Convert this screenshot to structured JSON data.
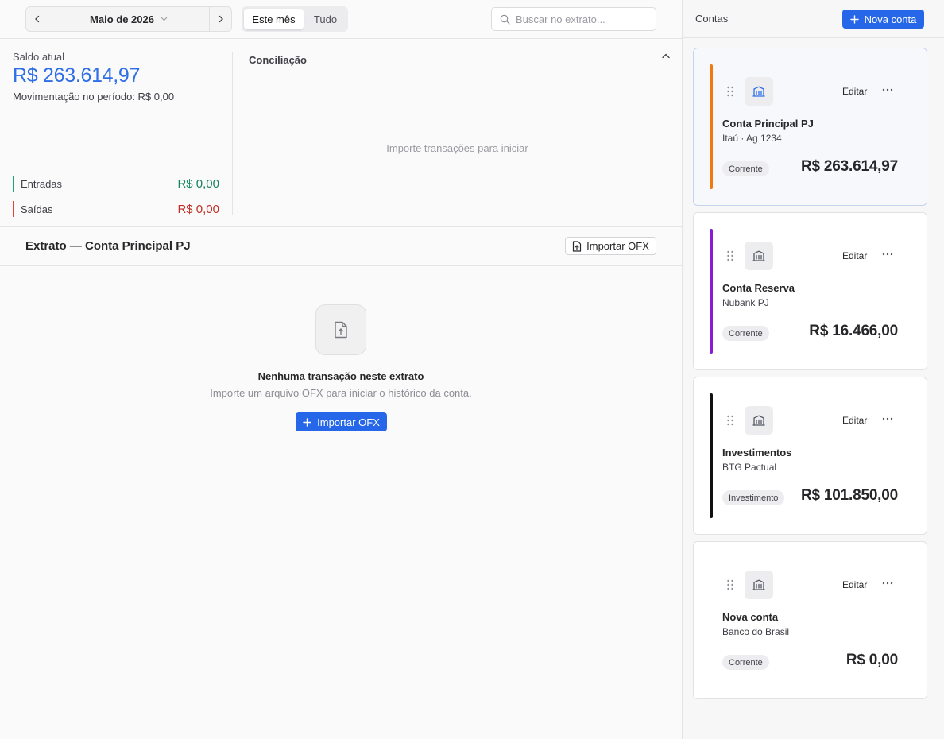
{
  "topbar": {
    "prev_label": "‹",
    "next_label": "›",
    "month_label": "Maio de 2026",
    "range_options": [
      "Este mês",
      "Tudo"
    ],
    "range_selected": "Este mês",
    "search_placeholder": "Buscar no extrato..."
  },
  "summary": {
    "saldo_label": "Saldo atual",
    "saldo_value": "R$ 263.614,97",
    "movement": "Movimentação no período: R$ 0,00",
    "entradas_label": "Entradas",
    "entradas_value": "R$ 0,00",
    "saidas_label": "Saídas",
    "saidas_value": "R$ 0,00"
  },
  "conciliacao": {
    "title": "Conciliação",
    "empty_text": "Importe transações para iniciar"
  },
  "extrato": {
    "title": "Extrato — Conta Principal PJ",
    "import_button": "Importar OFX",
    "empty_title": "Nenhuma transação neste extrato",
    "empty_subtitle": "Importe um arquivo OFX para iniciar o histórico da conta.",
    "empty_button": "Importar OFX"
  },
  "sidebar": {
    "title": "Contas",
    "new_button": "Nova conta",
    "edit_label": "Editar",
    "accounts": [
      {
        "name": "Conta Principal PJ",
        "subtitle": "Itaú · Ag 1234",
        "type": "Corrente",
        "balance": "R$ 263.614,97",
        "color": "#f07a12",
        "selected": true,
        "icon_color": "#2e6ee6"
      },
      {
        "name": "Conta Reserva",
        "subtitle": "Nubank PJ",
        "type": "Corrente",
        "balance": "R$ 16.466,00",
        "color": "#8a1bd6",
        "selected": false,
        "icon_color": "#555a63"
      },
      {
        "name": "Investimentos",
        "subtitle": "BTG Pactual",
        "type": "Investimento",
        "balance": "R$ 101.850,00",
        "color": "#111111",
        "selected": false,
        "icon_color": "#555a63"
      },
      {
        "name": "Nova conta",
        "subtitle": "Banco do Brasil",
        "type": "Corrente",
        "balance": "R$ 0,00",
        "color": "",
        "selected": false,
        "icon_color": "#555a63"
      }
    ]
  },
  "colors": {
    "accent": "#2567e8",
    "saldo": "#2e6ee6",
    "positive": "#16855f",
    "negative": "#c22d23"
  },
  "icons": [
    "chevron-left-icon",
    "chevron-right-icon",
    "chevron-down-icon",
    "search-icon",
    "chevron-up-icon",
    "file-upload-icon",
    "plus-icon",
    "drag-handle-icon",
    "bank-icon",
    "more-horizontal-icon"
  ]
}
